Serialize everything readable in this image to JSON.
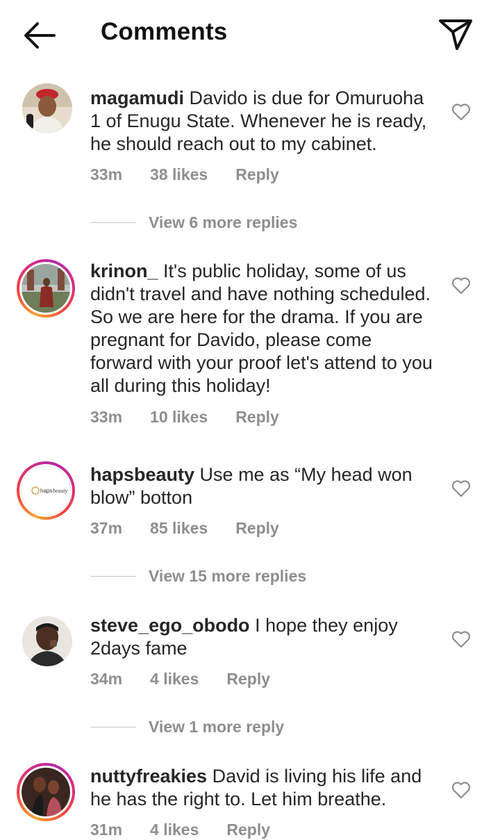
{
  "header": {
    "title": "Comments",
    "back_icon": "arrow-left-icon",
    "share_icon": "send-icon"
  },
  "comments": [
    {
      "username": "magamudi",
      "text": " Davido is due for Omuruoha 1 of Enugu State. Whenever he is ready, he should reach out to my cabinet.",
      "time": "33m",
      "likes": "38 likes",
      "reply": "Reply",
      "view_replies": "View 6 more replies",
      "story_ring": false
    },
    {
      "username": "krinon_",
      "text": " It's public holiday, some of us didn't travel and have nothing scheduled. So we are here for the drama. If you are pregnant for Davido, please come forward with your proof let's attend to you all during this holiday!",
      "time": "33m",
      "likes": "10 likes",
      "reply": "Reply",
      "view_replies": "",
      "story_ring": true
    },
    {
      "username": "hapsbeauty",
      "text": " Use me as “My head won blow” botton",
      "time": "37m",
      "likes": "85 likes",
      "reply": "Reply",
      "view_replies": "View 15 more replies",
      "story_ring": true,
      "avatar_text": "haps beauty"
    },
    {
      "username": "steve_ego_obodo",
      "text": " I hope they enjoy 2days fame",
      "time": "34m",
      "likes": "4 likes",
      "reply": "Reply",
      "view_replies": "View 1 more reply",
      "story_ring": false
    },
    {
      "username": "nuttyfreakies",
      "text": " David is living his life and he has the right to. Let him breathe.",
      "time": "31m",
      "likes": "4 likes",
      "reply": "Reply",
      "view_replies": "",
      "story_ring": true
    }
  ],
  "colors": {
    "meta": "#8e8e8e",
    "text": "#262626",
    "ring_start": "#f7a531",
    "ring_end": "#b32aa6"
  }
}
